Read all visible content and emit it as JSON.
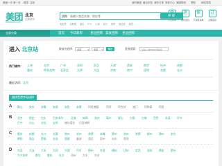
{
  "topbar": {
    "left1": "美团一次 美一天",
    "left2": "登录",
    "left3": "注册",
    "right": [
      "我的美团",
      "最近浏览",
      "我的订单",
      "商家中心",
      "美团规则",
      "帮助",
      "网站导航"
    ]
  },
  "header": {
    "logo": "美团",
    "logo_sub": "meituan.com",
    "city": "北京",
    "switch_city": "切换城市",
    "search_tab": "团购",
    "search_placeholder": "请输入商品名称、地址等",
    "search_button": "搜 索",
    "hot_links": [
      "电影票",
      "自助餐",
      "酒店",
      "KTV",
      "火锅",
      "足疗",
      "按摩",
      "周边游",
      "美发"
    ],
    "promos": [
      {
        "icon": "今",
        "label": "今日新单"
      },
      {
        "icon": "退",
        "label": "随时退款"
      },
      {
        "icon": "保",
        "label": "不满意免单"
      },
      {
        "icon": "过",
        "label": "过期退款"
      }
    ]
  },
  "nav": {
    "all": "全部分类",
    "items": [
      "首页",
      "今日新单",
      "身边团购",
      "美食团购",
      "身边团购"
    ]
  },
  "enter": {
    "prefix": "进入",
    "city": "北京站",
    "province_label": "按省份选择：",
    "province": "北京",
    "city_select": "北京",
    "go": "确定",
    "search_label": "直接搜索：",
    "search_placeholder": "请输入城市中文或拼音"
  },
  "hot_cities": {
    "title": "热门城市：",
    "row1": [
      "上海",
      "北京",
      "广州",
      "深圳",
      "武汉",
      "天津",
      "西安",
      "南京",
      "杭州",
      "成都"
    ],
    "row2": [
      "重庆",
      "呼和浩特",
      "石家庄",
      "太原",
      "大连",
      "济南",
      "南宁",
      "昆明",
      "合肥",
      "长沙"
    ]
  },
  "recent": {
    "label": "最近访问：",
    "city": "北京"
  },
  "letters": {
    "tab": "按拼音首字母选择",
    "groups": [
      {
        "letter": "A",
        "rows": [
          [
            "鞍山",
            "安庆",
            "安徽",
            "安顺",
            "安阳",
            "安康",
            "阿拉善盟",
            "阿坝",
            "阿克苏",
            "澳门",
            "阿勒泰",
            "阿里"
          ]
        ]
      },
      {
        "letter": "B",
        "rows": [
          [
            "北京",
            "保定",
            "包头",
            "巴彦淖尔",
            "北海",
            "蚌埠",
            "滨州",
            "亳州",
            "保山",
            "白银",
            "白城",
            "百色",
            "本溪",
            "毕节"
          ],
          [
            "巴中",
            "白山",
            "北屯",
            "宝鸡",
            "博尔塔拉",
            "巴音郭楞"
          ]
        ]
      },
      {
        "letter": "C",
        "rows": [
          [
            "重庆",
            "成都",
            "长沙",
            "长春",
            "常州",
            "沧州",
            "承德",
            "赤峰",
            "滁州",
            "池州",
            "常德",
            "郴州",
            "潮州",
            "崇左"
          ],
          [
            "朝阳",
            "昌吉",
            "楚雄",
            "长治",
            "昌都",
            "巢湖",
            "澄迈",
            "崇州",
            "从化",
            "常熟"
          ]
        ]
      },
      {
        "letter": "D",
        "rows": [
          [
            "东莞",
            "大连",
            "大庆",
            "大同",
            "大理",
            "丹东",
            "德州",
            "东营",
            "德阳",
            "达州",
            "定西",
            "迪庆",
            "德宏",
            "儋州"
          ],
          [
            "大兴安岭",
            "都匀",
            "敦化",
            "东方",
            "邓州",
            "大丰",
            "东台"
          ]
        ]
      }
    ]
  }
}
